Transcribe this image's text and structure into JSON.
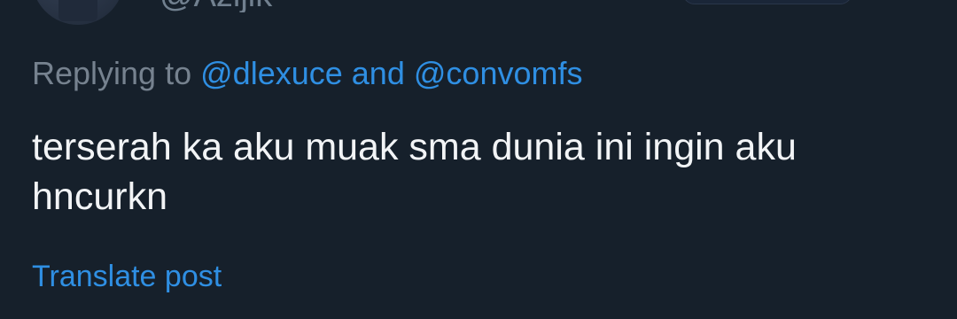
{
  "author": {
    "handle": "@Azijik"
  },
  "reply": {
    "prefix": "Replying to",
    "mention_1": "@dlexuce",
    "conjunction": "and",
    "mention_2": "@convomfs"
  },
  "post": {
    "text": "terserah ka aku muak sma dunia ini ingin aku hncurkn"
  },
  "actions": {
    "translate_label": "Translate post"
  },
  "colors": {
    "background": "#16202b",
    "text": "#f2f4f6",
    "muted": "#76828f",
    "link": "#2f8fe3"
  }
}
